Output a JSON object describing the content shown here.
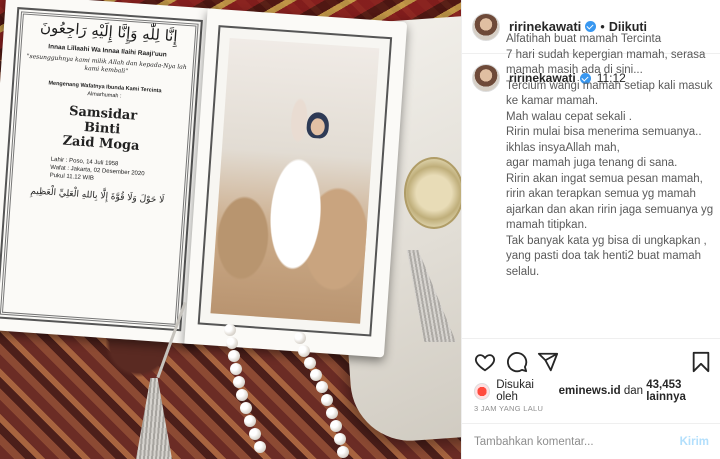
{
  "header": {
    "username": "ririnekawati",
    "separator": "•",
    "follow_label": "Diikuti"
  },
  "caption": {
    "username": "ririnekawati",
    "time": "11:12",
    "text": "Alfatihah buat mamah Tercinta\n7 hari sudah kepergian mamah, serasa mamah masih ada di sini...\nTercium wangi mamah setiap kali masuk ke kamar mamah.\nMah walau cepat sekali .\nRirin mulai bisa menerima semuanya..\nikhlas insyaAllah mah,\nagar mamah juga tenang di sana.\nRirin akan ingat semua pesan mamah, ririn akan terapkan semua yg mamah ajarkan dan akan ririn jaga semuanya yg mamah titipkan.\nTak banyak kata yg bisa di ungkapkan , yang pasti doa tak henti2 buat mamah selalu."
  },
  "likes": {
    "prefix": "Disukai oleh",
    "liked_by": "eminews.id",
    "connector": "dan",
    "count": "43,453 lainnya"
  },
  "timestamp": "3 JAM YANG LALU",
  "comment": {
    "placeholder": "Tambahkan komentar...",
    "send_label": "Kirim"
  },
  "card": {
    "arabic_top": "إِنَّا لِلّٰهِ وَإِنَّا إِلَيْهِ رَاجِعُونَ",
    "inna": "Innaa Lillaahi Wa Innaa Ilaihi Raaji'uun",
    "quote": "\"sesungguhnya kami milik Allah dan kepada-Nya lah kami kembali\"",
    "menge": "Mengenang Wafatnya Ibunda Kami Tercinta",
    "alm": "Almarhumah :",
    "name_1": "Samsidar",
    "name_2": "Binti",
    "name_3": "Zaid Moga",
    "born": "Lahir : Poso, 14 Juli 1958",
    "died": "Wafat : Jakarta, 02 Desember 2020",
    "hour": "Pukul 11.12 WIB",
    "arabic_bottom": "لَا حَوْلَ وَلَا قُوَّةَ إِلَّا بِاللهِ الْعَلِيِّ الْعَظِيمِ"
  },
  "colors": {
    "verified": "#3897f0",
    "send_disabled": "#b2dffc",
    "muted": "#8e8e8e"
  },
  "icons": [
    "heart-icon",
    "comment-icon",
    "share-icon",
    "bookmark-icon",
    "verified-icon"
  ]
}
